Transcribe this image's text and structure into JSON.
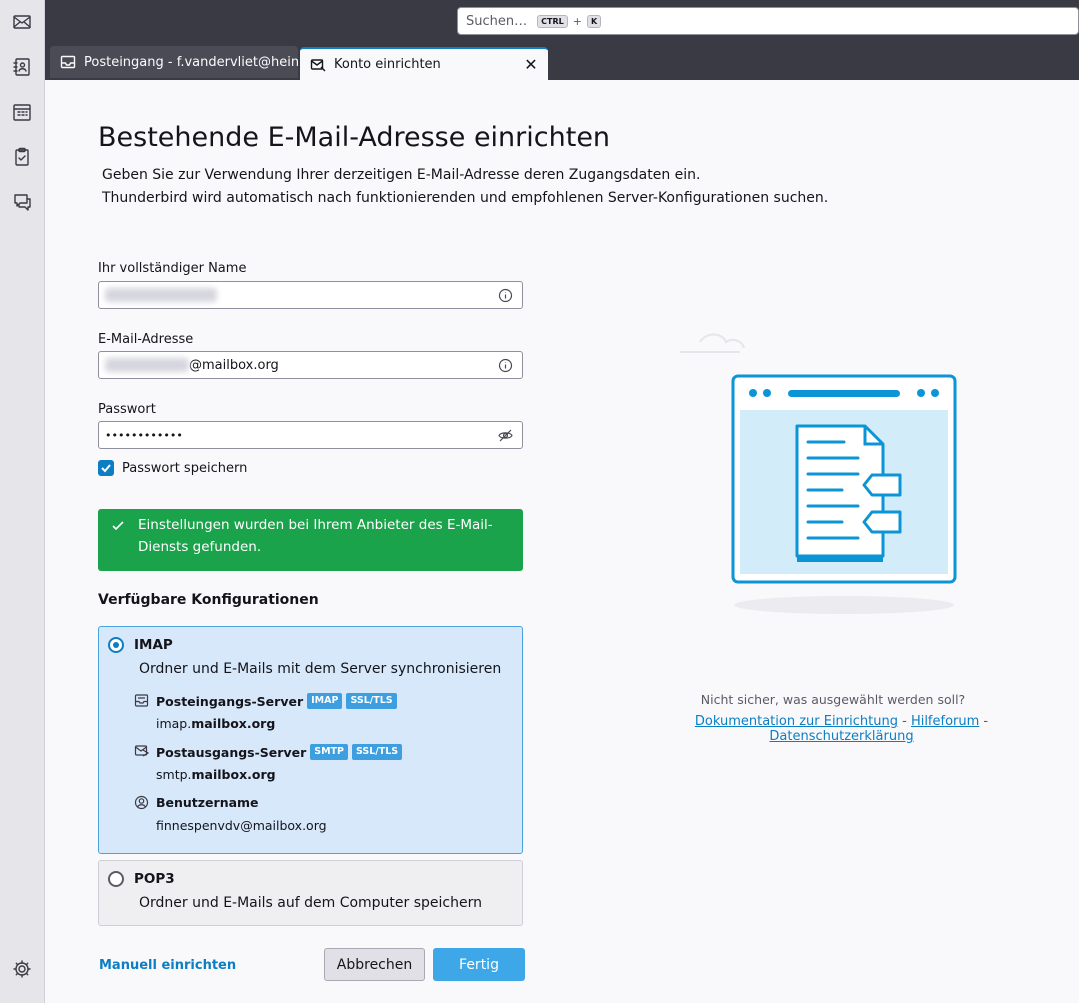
{
  "search": {
    "placeholder": "Suchen…",
    "key1": "CTRL",
    "plus": "+",
    "key2": "K"
  },
  "tabs": [
    {
      "label": "Posteingang - f.vandervliet@heinl"
    },
    {
      "label": "Konto einrichten",
      "close": "✕"
    }
  ],
  "page": {
    "title": "Bestehende E-Mail-Adresse einrichten",
    "desc1": "Geben Sie zur Verwendung Ihrer derzeitigen E-Mail-Adresse deren Zugangsdaten ein.",
    "desc2": "Thunderbird wird automatisch nach funktionierenden und empfohlenen Server-Konfigurationen suchen."
  },
  "form": {
    "name_label": "Ihr vollständiger Name",
    "email_label": "E-Mail-Adresse",
    "email_domain": "@mailbox.org",
    "password_label": "Passwort",
    "password_value": "••••••••••••",
    "remember_label": "Passwort speichern"
  },
  "notice": "Einstellungen wurden bei Ihrem Anbieter des E-Mail-Diensts gefunden.",
  "configs_title": "Verfügbare Konfigurationen",
  "imap": {
    "name": "IMAP",
    "desc": "Ordner und E-Mails mit dem Server synchronisieren",
    "incoming_title": "Posteingangs-Server",
    "incoming_badges": [
      "IMAP",
      "SSL/TLS"
    ],
    "incoming_host_prefix": "imap.",
    "incoming_host_domain": "mailbox.org",
    "outgoing_title": "Postausgangs-Server",
    "outgoing_badges": [
      "SMTP",
      "SSL/TLS"
    ],
    "outgoing_host_prefix": "smtp.",
    "outgoing_host_domain": "mailbox.org",
    "username_title": "Benutzername",
    "username_value": "finnespenvdv@mailbox.org"
  },
  "pop3": {
    "name": "POP3",
    "desc": "Ordner und E-Mails auf dem Computer speichern"
  },
  "actions": {
    "manual": "Manuell einrichten",
    "cancel": "Abbrechen",
    "done": "Fertig"
  },
  "help": {
    "question": "Nicht sicher, was ausgewählt werden soll?",
    "link1": "Dokumentation zur Einrichtung",
    "sep": " - ",
    "link2": "Hilfeforum",
    "link3": "Datenschutzerklärung"
  },
  "colors": {
    "accent": "#0c7ec4",
    "success": "#1aa34a",
    "selected_bg": "#d6e8fa"
  }
}
